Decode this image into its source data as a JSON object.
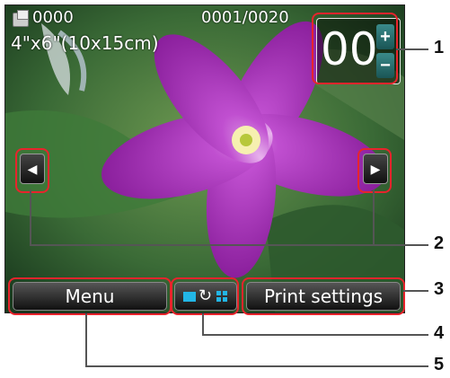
{
  "header": {
    "image_count": "0000",
    "page_counter": "0001/0020",
    "paper_size": "4\"x6\"(10x15cm)"
  },
  "copies": {
    "value": "00",
    "plus_label": "+",
    "minus_label": "−"
  },
  "navigation": {
    "prev_label": "◀",
    "next_label": "▶"
  },
  "buttons": {
    "menu_label": "Menu",
    "print_settings_label": "Print settings"
  },
  "view_switch": {
    "cycle_glyph": "↻",
    "icons": [
      "single-view-icon",
      "cycle-icon",
      "grid-view-icon"
    ]
  },
  "callouts": [
    "1",
    "2",
    "3",
    "4",
    "5"
  ],
  "colors": {
    "highlight": "#e8242c",
    "accent": "#22b6e6",
    "flower": "#b43dc4"
  }
}
